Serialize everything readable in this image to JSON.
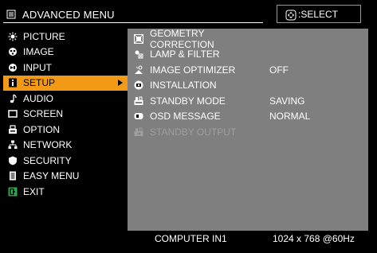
{
  "header": {
    "title": "ADVANCED MENU",
    "select_label": "SELECT"
  },
  "menu": [
    {
      "label": "PICTURE",
      "icon": "picture-icon"
    },
    {
      "label": "IMAGE",
      "icon": "image-icon"
    },
    {
      "label": "INPUT",
      "icon": "input-icon"
    },
    {
      "label": "SETUP",
      "icon": "setup-icon",
      "active": true
    },
    {
      "label": "AUDIO",
      "icon": "audio-icon"
    },
    {
      "label": "SCREEN",
      "icon": "screen-icon"
    },
    {
      "label": "OPTION",
      "icon": "option-icon"
    },
    {
      "label": "NETWORK",
      "icon": "network-icon"
    },
    {
      "label": "SECURITY",
      "icon": "security-icon"
    },
    {
      "label": "EASY MENU",
      "icon": "easy-menu-icon"
    },
    {
      "label": "EXIT",
      "icon": "exit-icon"
    }
  ],
  "submenu": [
    {
      "label": "GEOMETRY CORRECTION",
      "value": "",
      "icon": "geometry-icon"
    },
    {
      "label": "LAMP & FILTER",
      "value": "",
      "icon": "lamp-filter-icon"
    },
    {
      "label": "IMAGE OPTIMIZER",
      "value": "OFF",
      "icon": "image-optimizer-icon"
    },
    {
      "label": "INSTALLATION",
      "value": "",
      "icon": "installation-icon"
    },
    {
      "label": "STANDBY MODE",
      "value": "SAVING",
      "icon": "standby-mode-icon"
    },
    {
      "label": "OSD MESSAGE",
      "value": "NORMAL",
      "icon": "osd-message-icon"
    },
    {
      "label": "STANDBY OUTPUT",
      "value": "",
      "icon": "standby-output-icon",
      "disabled": true
    }
  ],
  "status": {
    "source": "COMPUTER IN1",
    "resolution": "1024 x 768 @60Hz"
  },
  "colors": {
    "active": "#f29a16",
    "panel": "#7f7f7f",
    "background": "#000000"
  }
}
